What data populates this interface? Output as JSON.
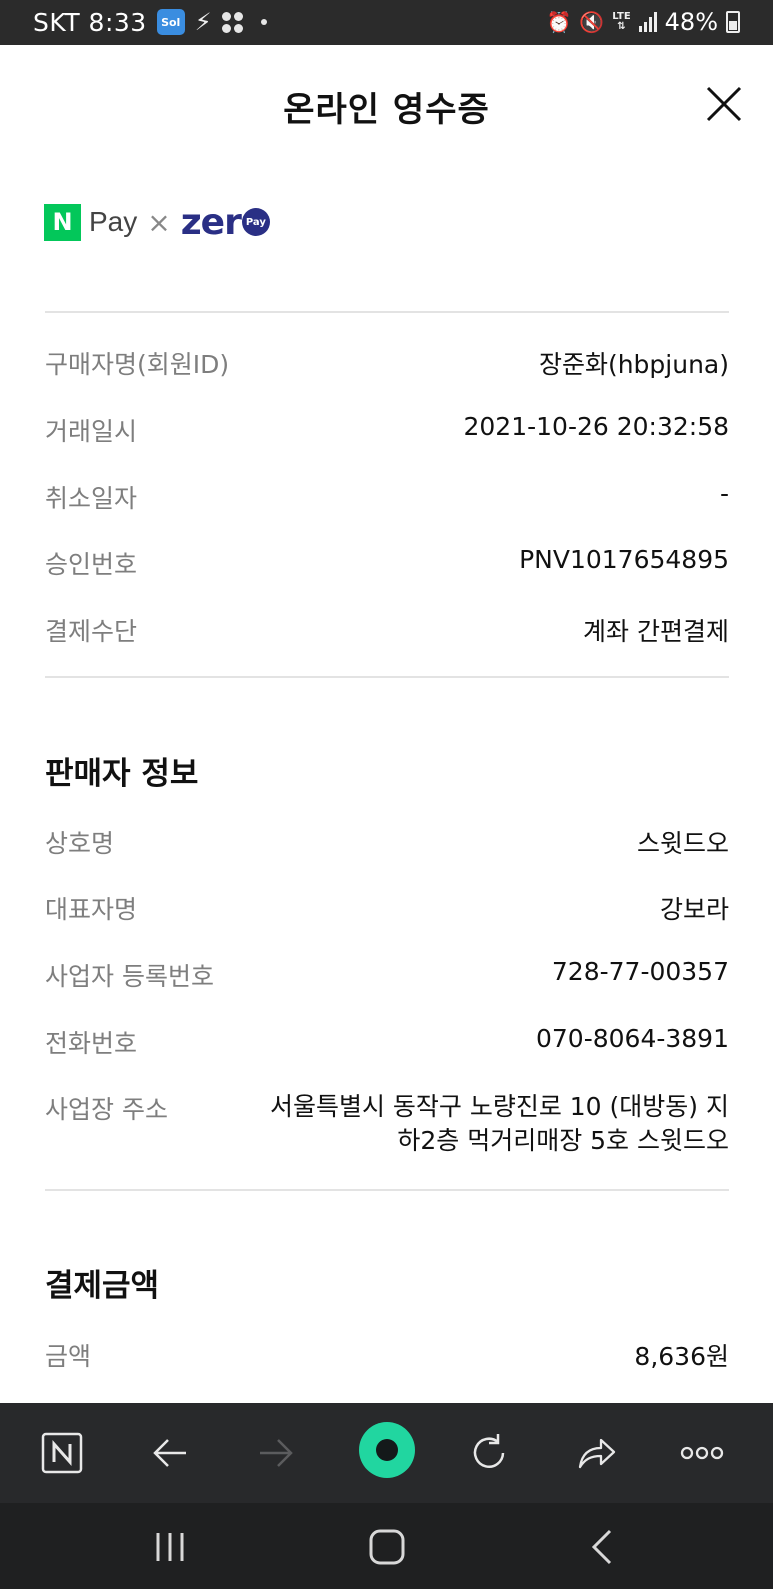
{
  "status_bar": {
    "carrier": "SKT",
    "time": "8:33",
    "app_badge": "Sol",
    "battery": "48%",
    "network": "LTE",
    "icons": [
      "sol-app-icon",
      "vpn-icon",
      "app-dots-icon",
      "notification-dot-icon",
      "alarm-icon",
      "mute-icon",
      "lte-icon",
      "signal-icon",
      "battery-icon"
    ]
  },
  "header": {
    "title": "온라인 영수증",
    "close_icon": "close-icon"
  },
  "logo": {
    "n_mark": "N",
    "pay": "Pay",
    "times": "×",
    "zero": "zer",
    "zero_badge": "Pay",
    "colors": {
      "naver_green": "#03c75a",
      "zero_navy": "#2a2f85"
    }
  },
  "transaction": [
    {
      "label": "구매자명(회원ID)",
      "value": "장준화(hbpjuna)"
    },
    {
      "label": "거래일시",
      "value": "2021-10-26 20:32:58"
    },
    {
      "label": "취소일자",
      "value": "-"
    },
    {
      "label": "승인번호",
      "value": "PNV1017654895"
    },
    {
      "label": "결제수단",
      "value": "계좌 간편결제"
    }
  ],
  "seller": {
    "title": "판매자 정보",
    "rows": [
      {
        "label": "상호명",
        "value": "스윗드오"
      },
      {
        "label": "대표자명",
        "value": "강보라"
      },
      {
        "label": "사업자 등록번호",
        "value": "728-77-00357"
      },
      {
        "label": "전화번호",
        "value": "070-8064-3891"
      }
    ],
    "address": {
      "label": "사업장 주소",
      "line1": "서울특별시 동작구 노량진로 10 (대방동) 지",
      "line2": "하2층 먹거리매장 5호 스윗드오"
    }
  },
  "payment": {
    "title": "결제금액",
    "rows": [
      {
        "label": "금액",
        "value": "8,636원"
      }
    ]
  },
  "browser_toolbar": {
    "buttons": [
      "naver-home-icon",
      "back-arrow-icon",
      "forward-arrow-icon",
      "green-dot-home-icon",
      "refresh-icon",
      "share-icon",
      "more-icon"
    ],
    "accent": "#21d6a0"
  },
  "nav_bar": {
    "buttons": [
      "recent-apps-icon",
      "home-icon",
      "back-icon"
    ]
  }
}
